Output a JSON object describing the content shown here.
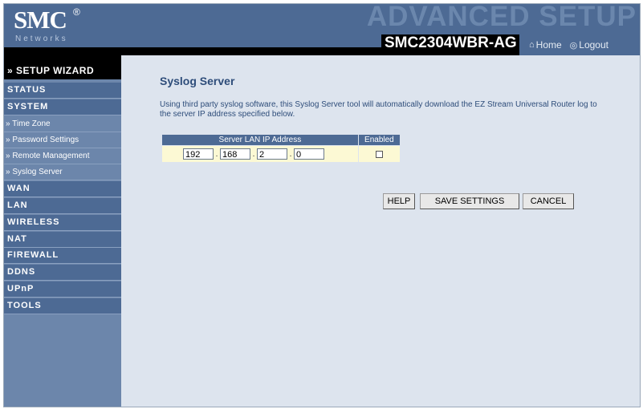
{
  "header": {
    "logo": "SMC",
    "logo_reg": "®",
    "logo_sub": "Networks",
    "banner": "ADVANCED SETUP",
    "model": "SMC2304WBR-AG",
    "home": "Home",
    "logout": "Logout",
    "home_icon": "home-icon",
    "logout_icon": "logout-icon"
  },
  "sidebar": {
    "wizard": "» SETUP WIZARD",
    "items": [
      {
        "label": "STATUS",
        "type": "menu"
      },
      {
        "label": "SYSTEM",
        "type": "menu"
      },
      {
        "label": "» Time Zone",
        "type": "sub"
      },
      {
        "label": "» Password Settings",
        "type": "sub"
      },
      {
        "label": "» Remote Management",
        "type": "sub"
      },
      {
        "label": "» Syslog Server",
        "type": "sub"
      },
      {
        "label": "WAN",
        "type": "menu"
      },
      {
        "label": "LAN",
        "type": "menu"
      },
      {
        "label": "WIRELESS",
        "type": "menu"
      },
      {
        "label": "NAT",
        "type": "menu"
      },
      {
        "label": "FIREWALL",
        "type": "menu"
      },
      {
        "label": "DDNS",
        "type": "menu"
      },
      {
        "label": "UPnP",
        "type": "menu"
      },
      {
        "label": "TOOLS",
        "type": "menu"
      }
    ]
  },
  "main": {
    "title": "Syslog Server",
    "description": "Using third party syslog software, this Syslog Server tool will automatically download the EZ Stream Universal Router log to the server IP address specified below.",
    "table": {
      "headers": [
        "Server LAN IP Address",
        "Enabled"
      ],
      "ip": [
        "192",
        "168",
        "2",
        "0"
      ],
      "enabled": false
    },
    "buttons": {
      "help": "HELP",
      "save": "SAVE SETTINGS",
      "cancel": "CANCEL"
    }
  }
}
